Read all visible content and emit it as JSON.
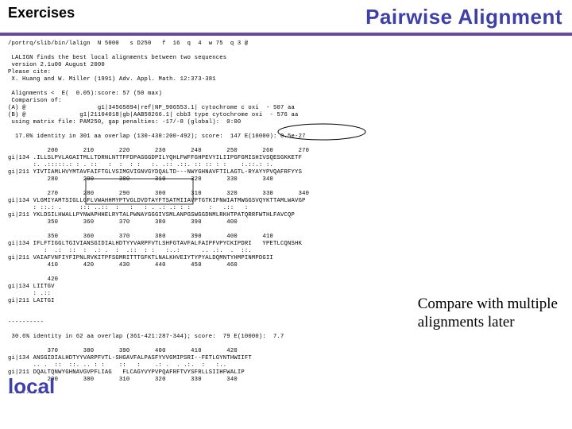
{
  "header": {
    "left": "Exercises",
    "right": "Pairwise Alignment"
  },
  "note": {
    "line1": "Compare with multiple",
    "line2": "alignments later"
  },
  "bottom_label": "local",
  "mono": {
    "l01": "/portrq/slib/bin/lalign  N 5000   s D250   f  16  q  4  w 75  q 3 @",
    "l02": " ",
    "l03": " LALIGN finds the best local alignments between two sequences",
    "l04": " version 2.1u00 August 2000",
    "l05": "Please cite:",
    "l06": " X. Huang and W. Miller (1991) Adv. Appl. Math. 12:373-381",
    "l07": " ",
    "l08": " Alignments <  E(  0.05):score: 57 (50 max)",
    "l09": " Comparison of:",
    "l10": "(A) @                    g1|34565894|ref|NP_906553.1| cytochrome c oxi  - 507 aa",
    "l11": "(B) @               g1|21104018|gb|AAB58266.1| cbb3 type cytochrome oxi  - 576 aa",
    "l12": " using matrix file: PAM250, gap penalties: -17/-8 (global):  0:00",
    "l13": " ",
    "l14": "  17.0% identity in 301 aa overlap (130-430:200-492); score:  147 E(10000): 0.5e-27",
    "l15": " ",
    "l16": "           200       210       220       230       240       250       260       270",
    "l17": "gi|134 .ILLSLPVLAGAITMLLTDRNLNTTFFDPAGGGDPILYQHLFWFFGHPEVYILIIPGFGMISHIVSQESGKKETF",
    "l18": "       :. .:::::.: : . ::   :  :  : :   :. .:: .::. :: :: : :    :.::.: :.",
    "l19": "gi|211 YIVTIAMLHVYMTAVFAIFTGLVSIMGVIGNVGYDQALTD---NWYGHNAVFTILAGTL-RYAYYPVQAFRFYYS",
    "l20": "           280       290       300       310       320       330       340",
    "l21": " ",
    "l22": "           270       280       290       300       310       320       330       340",
    "l23": "gi|134 VLGMIYAMTSIGLLGFLVWAHHMYPTVGLDVDTAYFTSATMIIAVPTGTKIFNWIATMWGGSVQYKTTAMLWAVGP",
    "l24": "       : ::.: .     ::: ..::  :   :   : . .: .: : :     :   .::   :  ",
    "l25": "gi|211 YKLDSILHWALLPYNWAPHHELRYTALPWNAYGGGIVSMLANPGSWGGDNMLRKHTPATQRRFWTHLFAVCQP",
    "l26": "           350       360       370       380       390       400",
    "l27": " ",
    "l28": "           350       360       370       380       390       400       410",
    "l29": "gi|134 IFLFTIGGLTGIVIANSGIDIALHDTYYVARPFVTLSHFGTAVFALFAIPFVPYCKIPDRI   YPETLCQNSHK",
    "l30": "          :  .:  ::  :  .: .  :  .::  : :   :..:      .. .:.  .  ::.",
    "l31": "gi|211 VAIAFVNFIYFIPNLRVKITPFSGMRITTTGFKTLNALKHVEIYTYPYALDQMNTYHMPINMPDGII",
    "l32": "           410       420       430       440       450       460",
    "l33": " ",
    "l34": "           420",
    "l35": "gi|134 LIITGV",
    "l36": "       : .::",
    "l37": "gi|211 LAITGI",
    "l38": " ",
    "l39": " ",
    "l40": "----------",
    "l41": " ",
    "l42": " 30.6% identity in 62 aa overlap (361-421:287-344); score:  79 E(10000):  7.7",
    "l43": " ",
    "l44": "           370       380       390       400       410       420",
    "l45": "gi|134 ANSGIDIALHDTYYVARPFVTL-SHGAVFALPASFYVVGMIPSRI--FETLGYNTHWIIFT",
    "l46": "       .. .  ::  ::. .. : :    ::   :    .: .  . .:.  :   :..     ",
    "l47": "gi|211 DQALTQNWYGHNAVGVPFLIAG   FLCAGYVYPVPQAFRFTVYSFRLLSIIHFWALIP",
    "l48": "           290       300       310       320       330       340",
    "l49": " ",
    "l50": "----------"
  }
}
